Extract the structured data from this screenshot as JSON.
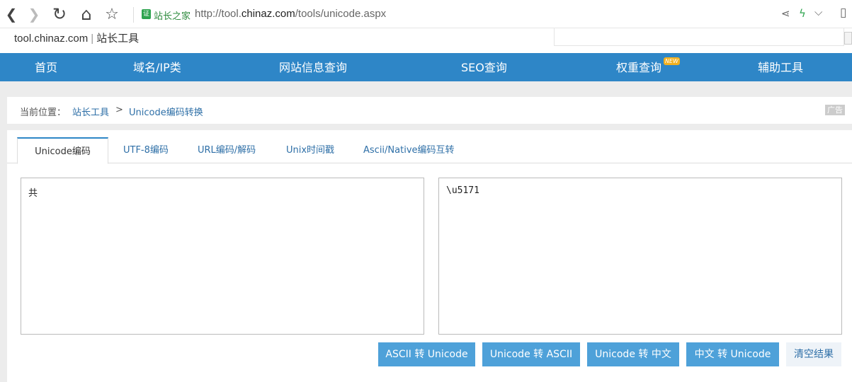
{
  "browser": {
    "back_icon": "❮",
    "forward_icon": "❯",
    "reload_icon": "↻",
    "home_icon": "⌂",
    "star_icon": "☆",
    "site_badge": "证",
    "site_name": "站长之家",
    "url_prefix": "http://tool.",
    "url_domain": "chinaz.com",
    "url_path": "/tools/unicode.aspx",
    "share_icon": "⋖",
    "bolt_icon": "ϟ",
    "dropdown_icon": "⌵",
    "doc_icon": "▯"
  },
  "header": {
    "logo_domain": "tool.chinaz.com",
    "logo_sep": "|",
    "logo_name": "站长工具"
  },
  "nav": {
    "items": [
      {
        "label": "首页"
      },
      {
        "label": "域名/IP类"
      },
      {
        "label": "网站信息查询"
      },
      {
        "label": "SEO查询"
      },
      {
        "label": "权重查询",
        "badge": "NEW"
      },
      {
        "label": "辅助工具"
      }
    ]
  },
  "breadcrumb": {
    "prefix": "当前位置：",
    "crumb1": "站长工具",
    "arrow": ">",
    "crumb2": "Unicode编码转换",
    "ad": "广告"
  },
  "tabs": [
    {
      "label": "Unicode编码"
    },
    {
      "label": "UTF-8编码"
    },
    {
      "label": "URL编码/解码"
    },
    {
      "label": "Unix时间戳"
    },
    {
      "label": "Ascii/Native编码互转"
    }
  ],
  "input": {
    "value": "共"
  },
  "output": {
    "value": "\\u5171"
  },
  "buttons": {
    "ascii_to_unicode": "ASCII 转 Unicode",
    "unicode_to_ascii": "Unicode 转 ASCII",
    "unicode_to_chinese": "Unicode 转 中文",
    "chinese_to_unicode": "中文 转 Unicode",
    "clear": "清空结果"
  },
  "colors": {
    "nav_bg": "#2e86c7",
    "button_bg": "#4ea1d9",
    "link": "#2e6fa7"
  }
}
